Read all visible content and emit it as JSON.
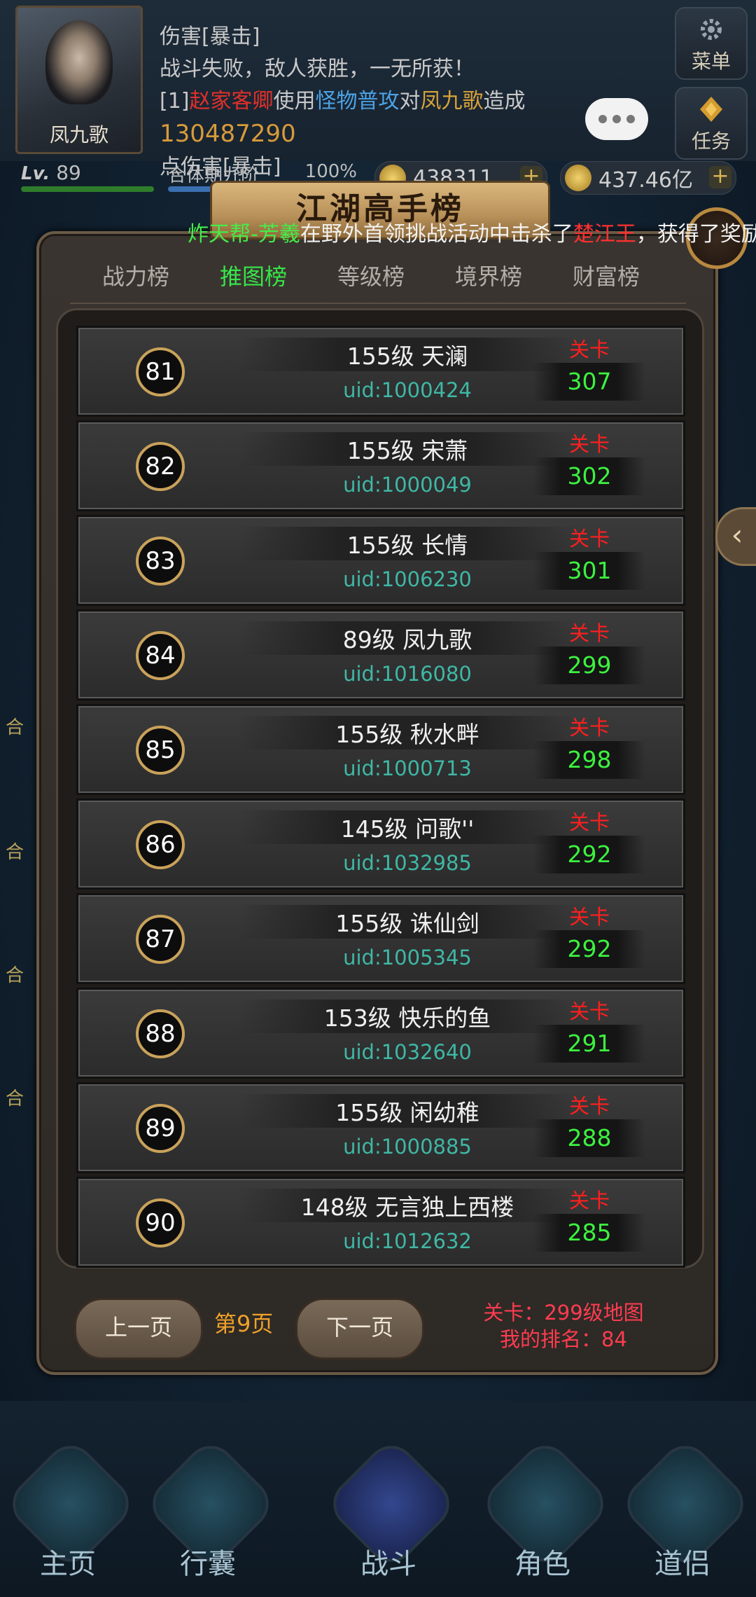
{
  "player": {
    "name": "凤九歌"
  },
  "log": {
    "line1": "伤害[暴击]",
    "line2": "战斗失败，敌人获胜，一无所获！",
    "line3_prefix": "[1]",
    "line3_actor": "赵家客卿",
    "line3_use": "使用",
    "line3_skill": "怪物普攻",
    "line3_to": "对",
    "line3_target": "凤九歌",
    "line3_cause": "造成",
    "line3_dmg": "130487290",
    "line4": "点伤害[暴击]"
  },
  "side_buttons": {
    "menu": "菜单",
    "task": "任务"
  },
  "status": {
    "lv_prefix": "Lv.",
    "level": "89",
    "realm": "合体期九阶",
    "realm_pct": "100%",
    "coin1": "438311",
    "coin2": "437.46亿",
    "plus": "+"
  },
  "panel": {
    "title": "江湖高手榜",
    "ticker": {
      "guild": "炸天帮-芳羲",
      "mid": "在野外首领挑战活动中击杀了",
      "boss": "楚江王",
      "tail": "，获得了奖励"
    },
    "tabs": [
      {
        "label": "战力榜",
        "active": false
      },
      {
        "label": "推图榜",
        "active": true
      },
      {
        "label": "等级榜",
        "active": false
      },
      {
        "label": "境界榜",
        "active": false
      },
      {
        "label": "财富榜",
        "active": false
      }
    ],
    "stage_label": "关卡",
    "rows": [
      {
        "rank": "81",
        "name": "155级 天澜",
        "uid": "uid:1000424",
        "stage": "307"
      },
      {
        "rank": "82",
        "name": "155级 宋萧",
        "uid": "uid:1000049",
        "stage": "302"
      },
      {
        "rank": "83",
        "name": "155级 长情",
        "uid": "uid:1006230",
        "stage": "301"
      },
      {
        "rank": "84",
        "name": "89级 凤九歌",
        "uid": "uid:1016080",
        "stage": "299"
      },
      {
        "rank": "85",
        "name": "155级 秋水畔",
        "uid": "uid:1000713",
        "stage": "298"
      },
      {
        "rank": "86",
        "name": "145级 问歌''",
        "uid": "uid:1032985",
        "stage": "292"
      },
      {
        "rank": "87",
        "name": "155级 诛仙剑",
        "uid": "uid:1005345",
        "stage": "292"
      },
      {
        "rank": "88",
        "name": "153级 快乐的鱼",
        "uid": "uid:1032640",
        "stage": "291"
      },
      {
        "rank": "89",
        "name": "155级 闲幼稚",
        "uid": "uid:1000885",
        "stage": "288"
      },
      {
        "rank": "90",
        "name": "148级 无言独上西楼",
        "uid": "uid:1012632",
        "stage": "285"
      }
    ],
    "pager": {
      "prev": "上一页",
      "page": "第9页",
      "next": "下一页",
      "my_stage": "关卡：299级地图",
      "my_rank": "我的排名：84"
    }
  },
  "side_ticks": [
    "合",
    "合",
    "合",
    "合"
  ],
  "bottom_nav": [
    "主页",
    "行囊",
    "战斗",
    "角色",
    "道侣"
  ]
}
